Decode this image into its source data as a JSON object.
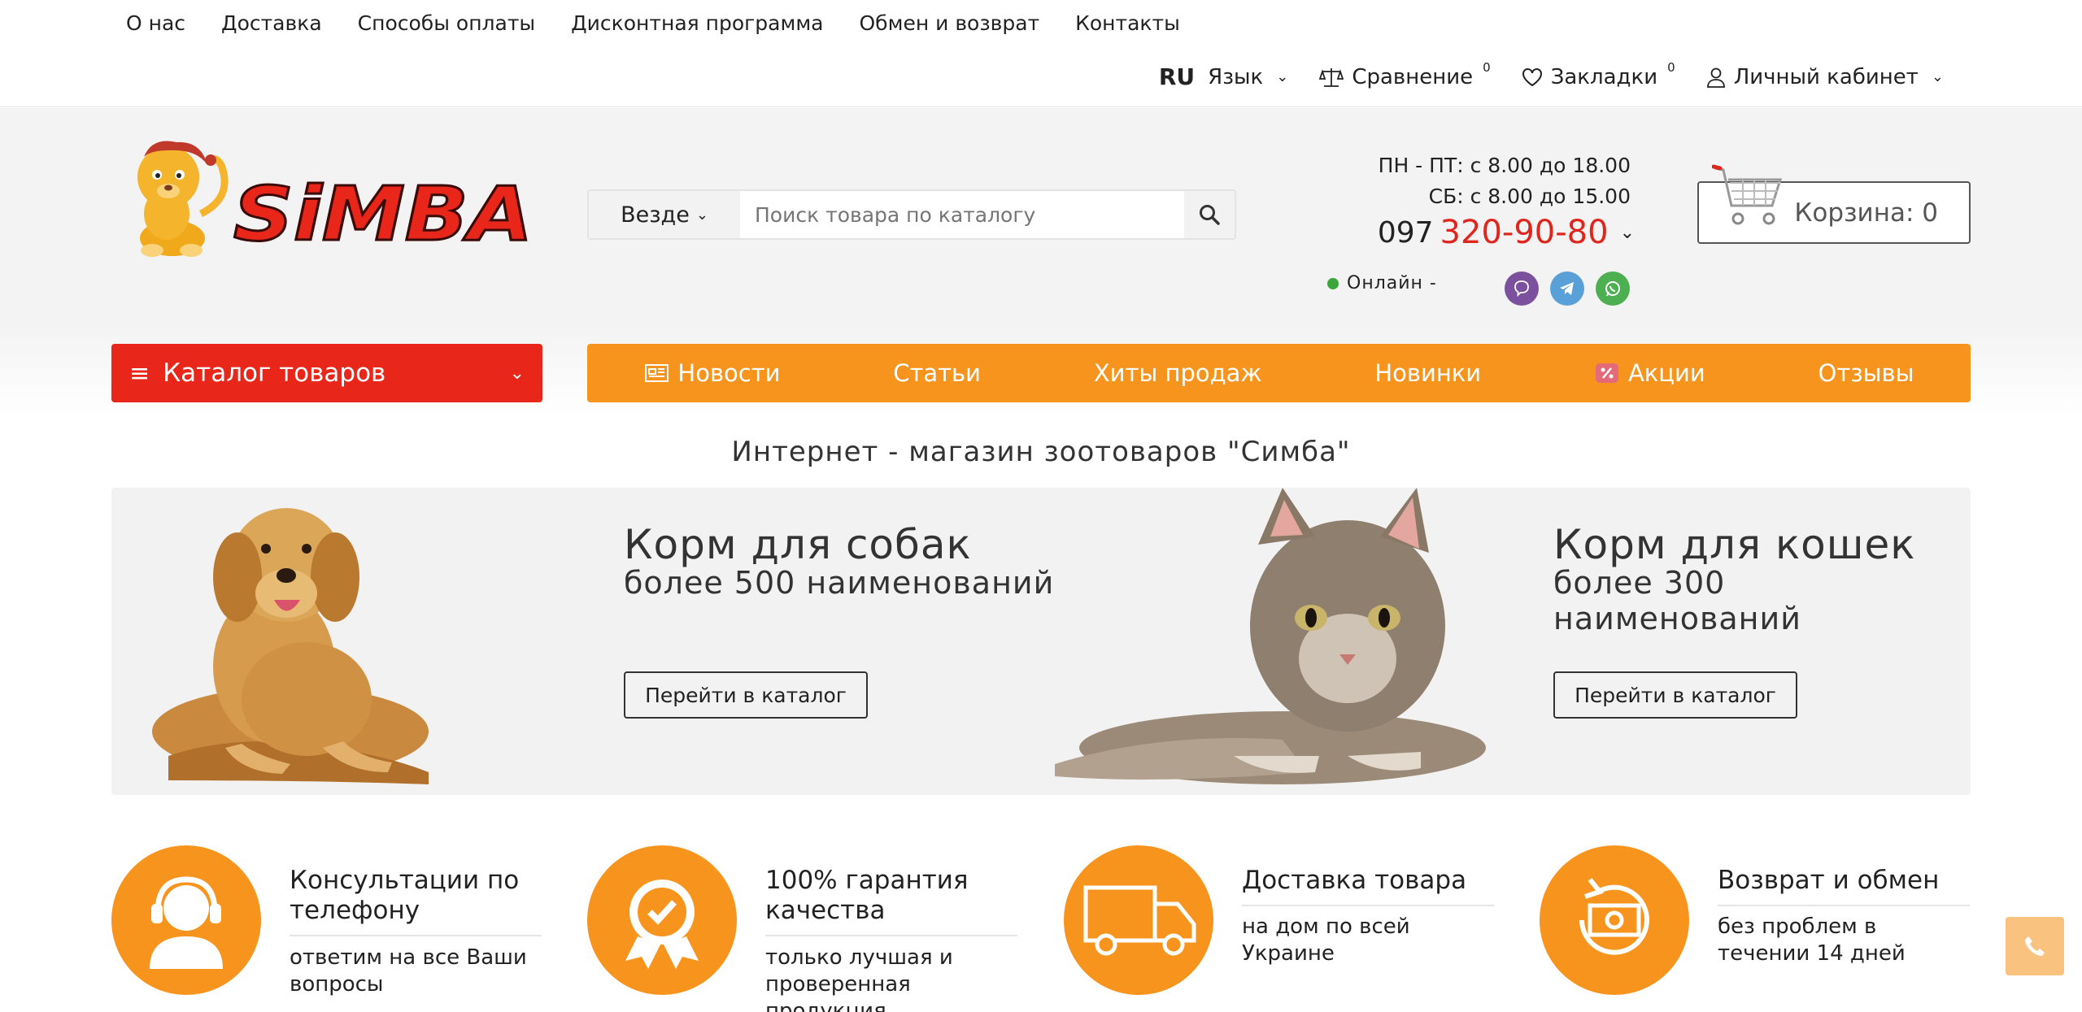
{
  "top_links": [
    "О нас",
    "Доставка",
    "Способы оплаты",
    "Дисконтная программа",
    "Обмен и возврат",
    "Контакты"
  ],
  "top_right": {
    "lang_code": "RU",
    "lang_label": "Язык",
    "compare_label": "Сравнение",
    "compare_count": "0",
    "bookmarks_label": "Закладки",
    "bookmarks_count": "0",
    "account_label": "Личный кабинет"
  },
  "logo": {
    "text": "SiMBA"
  },
  "search": {
    "scope": "Везде",
    "placeholder": "Поиск товара по каталогу"
  },
  "contacts": {
    "hours_weekdays": "ПН - ПТ: с 8.00 до 18.00",
    "hours_saturday": "СБ: с 8.00 до 15.00",
    "phone_prefix": "097",
    "phone_number": "320-90-80",
    "online_label": "Онлайн -"
  },
  "cart": {
    "label": "Корзина: 0"
  },
  "catalog_button": "Каталог товаров",
  "main_menu": [
    "Новости",
    "Статьи",
    "Хиты продаж",
    "Новинки",
    "Акции",
    "Отзывы"
  ],
  "hero_title": "Интернет - магазин зоотоваров \"Симба\"",
  "banners": [
    {
      "title": "Корм для собак",
      "subtitle": "более 500 наименований",
      "button": "Перейти в каталог"
    },
    {
      "title": "Корм для кошек",
      "subtitle": "более 300 наименований",
      "button": "Перейти в каталог"
    }
  ],
  "features": [
    {
      "title": "Консультации по телефону",
      "desc": "ответим на все Ваши вопросы",
      "icon": "headset-icon"
    },
    {
      "title": "100% гарантия качества",
      "desc": "только лучшая и проверенная продукция",
      "icon": "quality-badge-icon"
    },
    {
      "title": "Доставка товара",
      "desc": "на дом по всей Украине",
      "icon": "delivery-truck-icon"
    },
    {
      "title": "Возврат и обмен",
      "desc": "без проблем в течении 14 дней",
      "icon": "return-exchange-icon"
    }
  ],
  "colors": {
    "accent_orange": "#f7941d",
    "accent_red": "#e8261a",
    "phone_red": "#e0261c"
  }
}
